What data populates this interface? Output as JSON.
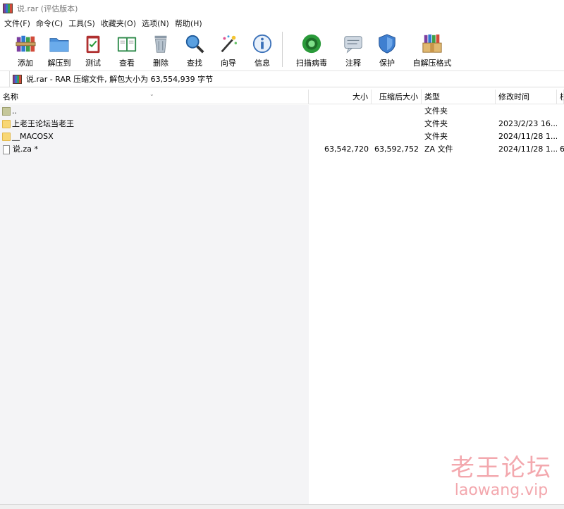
{
  "window": {
    "title": "说.rar (评估版本)"
  },
  "menu": [
    "文件(F)",
    "命令(C)",
    "工具(S)",
    "收藏夹(O)",
    "选项(N)",
    "帮助(H)"
  ],
  "toolbar": {
    "add": "添加",
    "extract": "解压到",
    "test": "测试",
    "view": "查看",
    "delete": "删除",
    "find": "查找",
    "wizard": "向导",
    "info": "信息",
    "virus": "扫描病毒",
    "comment": "注释",
    "protect": "保护",
    "sfx": "自解压格式"
  },
  "address": {
    "text": "说.rar - RAR 压缩文件, 解包大小为 63,554,939 字节"
  },
  "columns": {
    "name": "名称",
    "size": "大小",
    "packed": "压缩后大小",
    "type": "类型",
    "modified": "修改时间",
    "crc": "校"
  },
  "files": [
    {
      "name": "..",
      "size": "",
      "packed": "",
      "type": "文件夹",
      "modified": "",
      "crc": ""
    },
    {
      "name": "上老王论坛当老王",
      "size": "",
      "packed": "",
      "type": "文件夹",
      "modified": "2023/2/23 16...",
      "crc": ""
    },
    {
      "name": "__MACOSX",
      "size": "",
      "packed": "",
      "type": "文件夹",
      "modified": "2024/11/28 1...",
      "crc": ""
    },
    {
      "name": "说.za *",
      "size": "63,542,720",
      "packed": "63,592,752",
      "type": "ZA 文件",
      "modified": "2024/11/28 1...",
      "crc": "6"
    }
  ],
  "watermark": {
    "cn": "老王论坛",
    "en": "laowang.vip"
  }
}
